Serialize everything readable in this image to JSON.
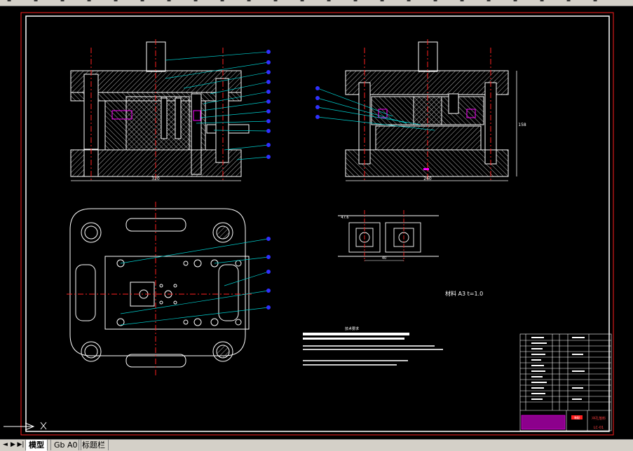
{
  "toolbar": {
    "icons": [
      "new-icon",
      "open-icon",
      "save-icon",
      "print-icon",
      "preview-icon",
      "cut-icon",
      "copy-icon",
      "paste-icon",
      "match-icon",
      "undo-icon",
      "redo-icon",
      "pan-icon",
      "zoom-realtime-icon",
      "zoom-window-icon",
      "zoom-previous-icon",
      "properties-icon",
      "design-center-icon",
      "tool-palette-icon",
      "sheet-set-icon",
      "markup-icon",
      "calculator-icon",
      "help-icon",
      "layer-icon"
    ]
  },
  "drawing": {
    "material_label": "材料 A3  t=1.0",
    "notes_title": "技术要求",
    "dims": {
      "front_width": "320",
      "side_width": "260",
      "side_height": "158",
      "strip_pitch": "40",
      "strip_width": "47.6"
    },
    "titleblock": {
      "drawing_name": "冲孔落料",
      "drawing_no": "LC-01",
      "stamp": "装配"
    }
  },
  "colors": {
    "background": "#000000",
    "lines": "#ffffff",
    "border": "#ff0000",
    "leaders": "#00ffff",
    "balloons": "#4040ff",
    "center": "#ff0000",
    "accent": "#ff00ff"
  },
  "tabs": {
    "items": [
      "模型",
      "Gb A0",
      "标题栏"
    ],
    "active": 0
  }
}
